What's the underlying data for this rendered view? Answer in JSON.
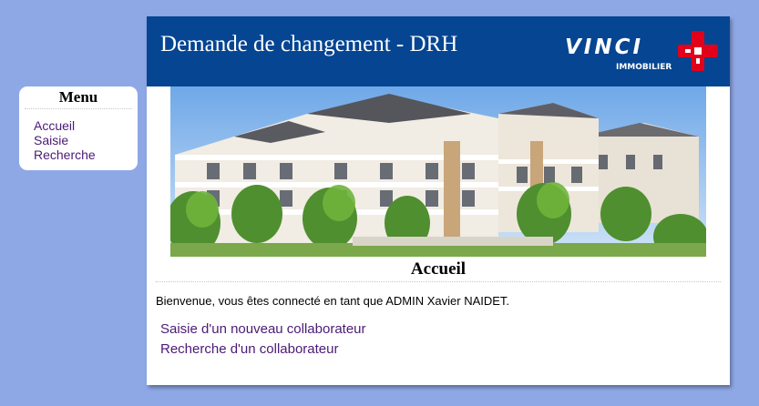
{
  "menu": {
    "title": "Menu",
    "items": [
      {
        "label": "Accueil"
      },
      {
        "label": "Saisie"
      },
      {
        "label": "Recherche"
      }
    ]
  },
  "header": {
    "title": "Demande de changement - DRH",
    "logo_text": "VINCI",
    "logo_subtext": "IMMOBILIER",
    "colors": {
      "background": "#054592",
      "logo_accent": "#e2001a"
    }
  },
  "main": {
    "page_title": "Accueil",
    "welcome_text": "Bienvenue, vous êtes connecté en tant que ADMIN Xavier NAIDET.",
    "links": [
      {
        "label": "Saisie d'un nouveau collaborateur"
      },
      {
        "label": "Recherche d'un collaborateur"
      }
    ]
  },
  "colors": {
    "page_background": "#8ea8e6",
    "link": "#4b1a76"
  }
}
